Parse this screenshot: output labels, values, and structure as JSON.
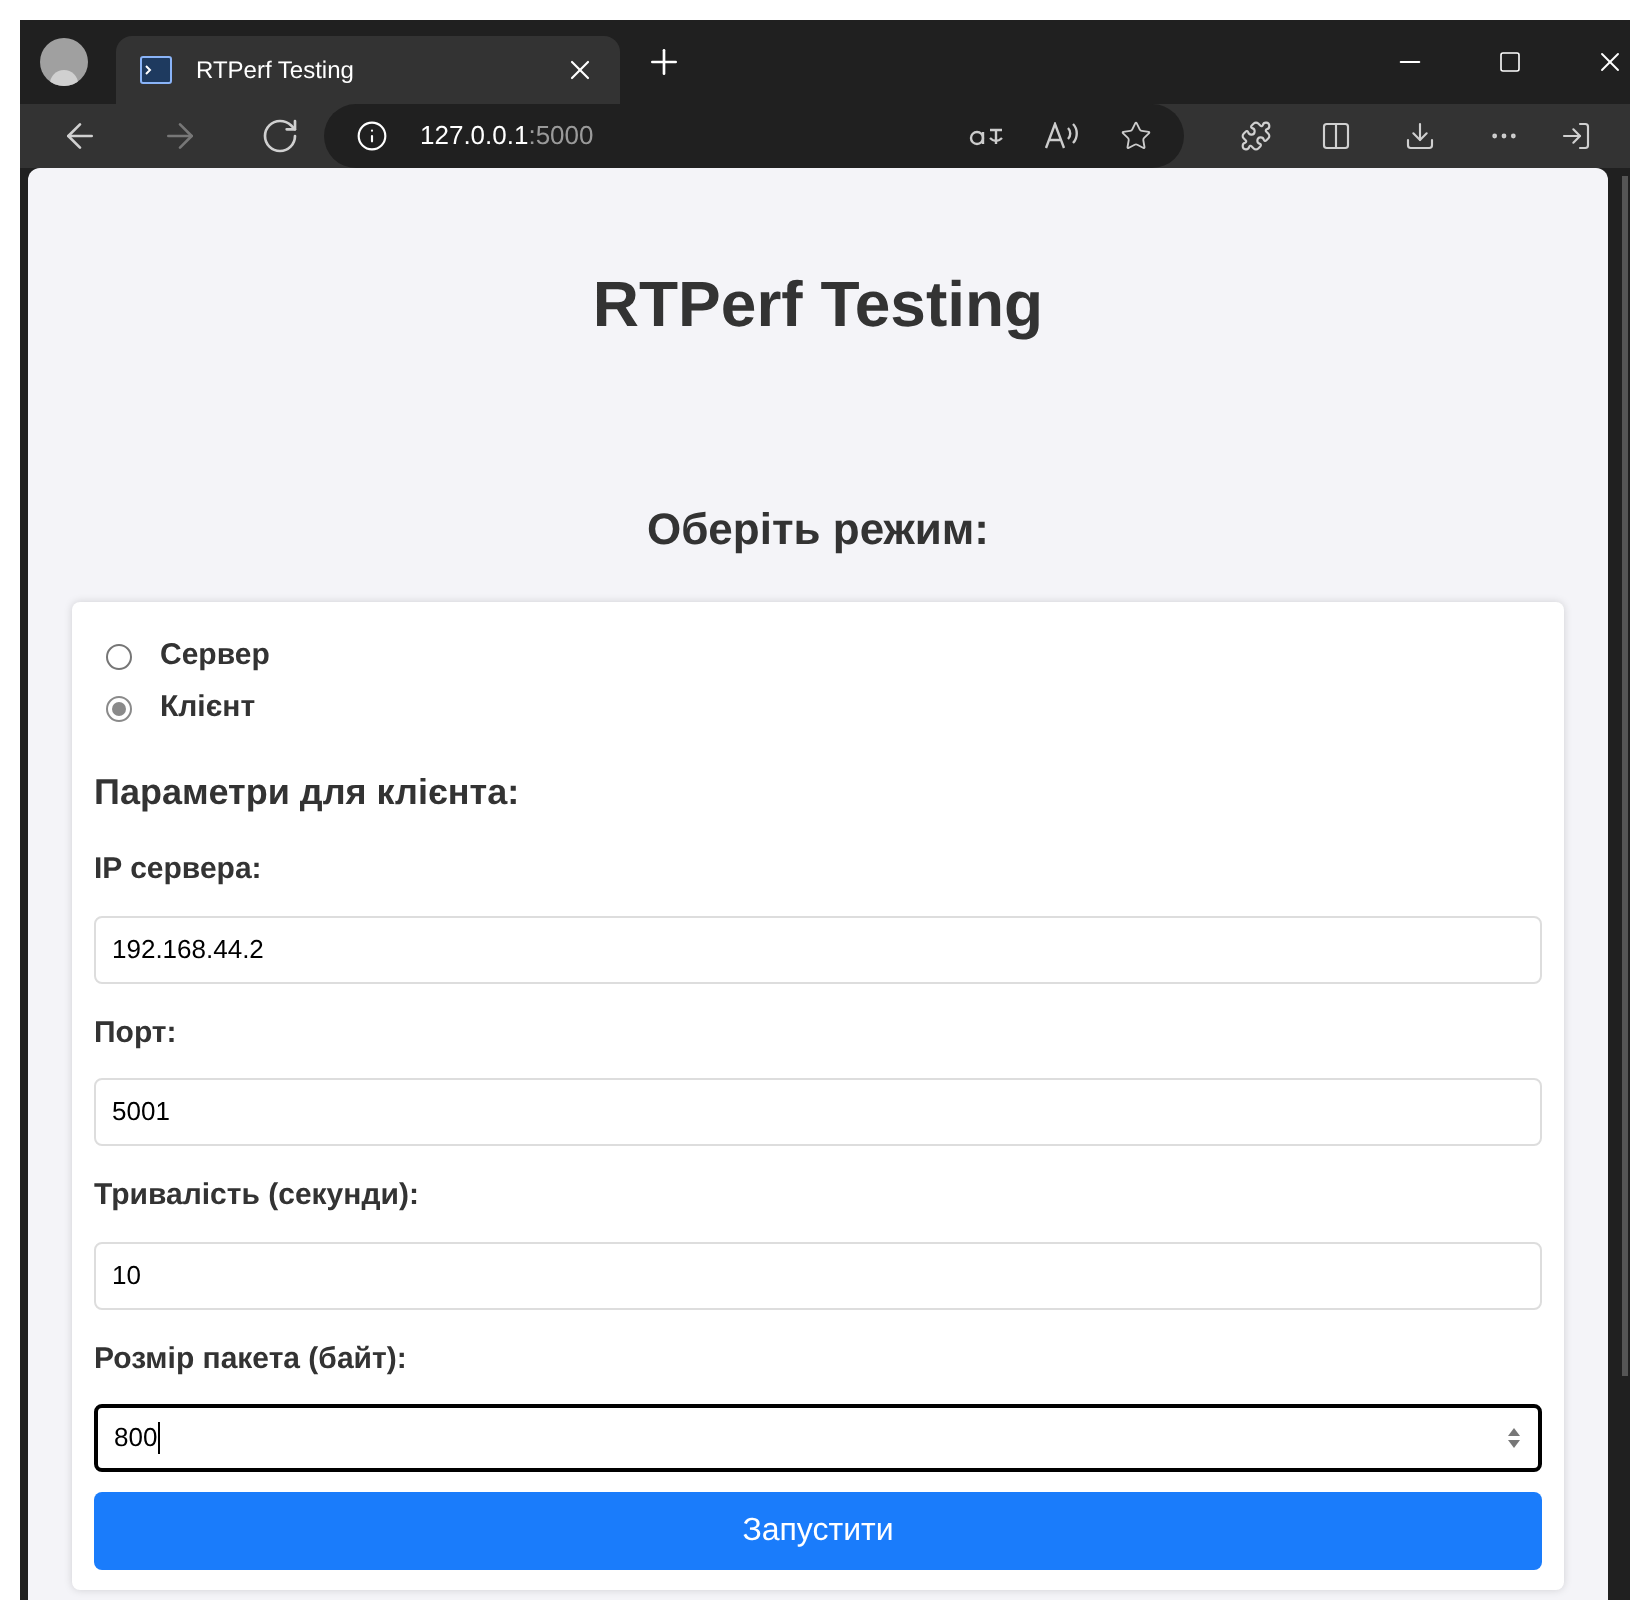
{
  "browser": {
    "tab_title": "RTPerf Testing",
    "url_host": "127.0.0.1",
    "url_port": ":5000"
  },
  "page": {
    "title": "RTPerf Testing",
    "mode_heading": "Оберіть режим:",
    "modes": [
      {
        "label": "Сервер",
        "selected": false
      },
      {
        "label": "Клієнт",
        "selected": true
      }
    ],
    "params_heading": "Параметри для клієнта:",
    "fields": [
      {
        "label": "IP сервера:",
        "value": "192.168.44.2",
        "kind": "text",
        "focused": false
      },
      {
        "label": "Порт:",
        "value": "5001",
        "kind": "text",
        "focused": false
      },
      {
        "label": "Тривалість (секунди):",
        "value": "10",
        "kind": "text",
        "focused": false
      },
      {
        "label": "Розмір пакета (байт):",
        "value": "800",
        "kind": "number",
        "focused": true
      }
    ],
    "submit": "Запустити"
  }
}
